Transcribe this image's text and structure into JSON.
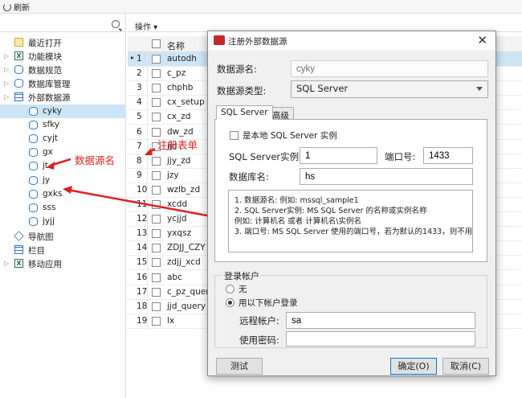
{
  "toolbar": {
    "refresh": "刷新"
  },
  "sidebar": {
    "items": [
      {
        "label": "最近打开",
        "icon": "folder-icon"
      },
      {
        "label": "功能模块",
        "icon": "excel-icon"
      },
      {
        "label": "数据规范",
        "icon": "database-icon"
      },
      {
        "label": "数据库管理",
        "icon": "database-icon"
      },
      {
        "label": "外部数据源",
        "icon": "grid-icon"
      },
      {
        "label": "cyky",
        "icon": "database-icon"
      },
      {
        "label": "sfky",
        "icon": "database-icon"
      },
      {
        "label": "cyjt",
        "icon": "database-icon"
      },
      {
        "label": "gx",
        "icon": "database-icon"
      },
      {
        "label": "jt",
        "icon": "database-icon"
      },
      {
        "label": "jy",
        "icon": "database-icon"
      },
      {
        "label": "gxks",
        "icon": "database-icon"
      },
      {
        "label": "sss",
        "icon": "database-icon"
      },
      {
        "label": "jyjj",
        "icon": "database-icon"
      },
      {
        "label": "导航图",
        "icon": "navigation-icon"
      },
      {
        "label": "栏目",
        "icon": "grid-icon"
      },
      {
        "label": "移动应用",
        "icon": "excel-icon"
      }
    ]
  },
  "annotations": {
    "datasource_name": "数据源名",
    "register_table": "注册表单"
  },
  "grid": {
    "operations": "操作",
    "name_header": "名称",
    "rows": [
      {
        "num": "1",
        "name": "autodh"
      },
      {
        "num": "2",
        "name": "c_pz"
      },
      {
        "num": "3",
        "name": "chphb"
      },
      {
        "num": "4",
        "name": "cx_setup"
      },
      {
        "num": "5",
        "name": "cx_zd"
      },
      {
        "num": "6",
        "name": "dw_zd"
      },
      {
        "num": "7",
        "name": "jjd"
      },
      {
        "num": "8",
        "name": "jjy_zd"
      },
      {
        "num": "9",
        "name": "jzy"
      },
      {
        "num": "10",
        "name": "wzlb_zd"
      },
      {
        "num": "11",
        "name": "xcdd"
      },
      {
        "num": "12",
        "name": "ycjjd"
      },
      {
        "num": "13",
        "name": "yxqsz"
      },
      {
        "num": "14",
        "name": "ZDJJ_CZY"
      },
      {
        "num": "15",
        "name": "zdjj_xcd"
      },
      {
        "num": "16",
        "name": "abc"
      },
      {
        "num": "17",
        "name": "c_pz_query"
      },
      {
        "num": "18",
        "name": "jjd_query"
      },
      {
        "num": "19",
        "name": "lx"
      }
    ]
  },
  "dialog": {
    "title": "注册外部数据源",
    "ds_name_label": "数据源名:",
    "ds_name_placeholder": "cyky",
    "ds_type_label": "数据源类型:",
    "ds_type_value": "SQL Server",
    "tabs": [
      "SQL Server",
      "高级"
    ],
    "local_label": "是本地 SQL Server 实例",
    "instance_label": "SQL Server实例:",
    "instance_value": "1",
    "port_label": "端口号:",
    "port_value": "1433",
    "db_label": "数据库名:",
    "db_value": "hs",
    "help": [
      "1. 数据源名:       例如: mssql_sample1",
      "2. SQL Server实例:   MS SQL Server 的名称或实例名称",
      "    例如: 计算机名 或者 计算机名\\实例名",
      "3. 端口号:    MS SQL Server 使用的端口号，若为默认的1433，则不用"
    ],
    "login_group": "登录帐户",
    "radio_none": "无",
    "radio_use": "用以下帐户登录",
    "remote_label": "远程帐户:",
    "remote_value": "sa",
    "password_label": "使用密码:",
    "password_value": "",
    "btn_test": "测试",
    "btn_ok": "确定(O)",
    "btn_cancel": "取消(C)"
  }
}
